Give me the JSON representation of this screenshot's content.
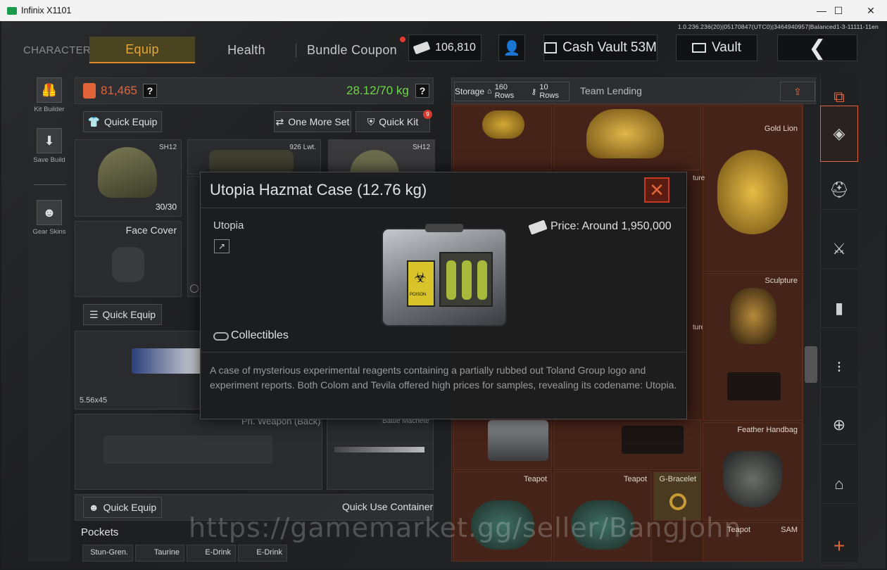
{
  "window": {
    "title": "Infinix X1101",
    "minimize": "—",
    "maximize": "☐",
    "close": "✕"
  },
  "version": "1.0.236.236(20)|05170847(UTC0)|3464940957|Balanced1-3-11111-11en",
  "tabs": {
    "character": "CHARACTER",
    "equip": "Equip",
    "health": "Health",
    "bundle": "Bundle Coupon"
  },
  "currency": {
    "cash": "106,810",
    "cash_vault": "Cash Vault 53M",
    "vault": "Vault"
  },
  "left_nav": {
    "kit_builder": "Kit Builder",
    "save_build": "Save Build",
    "gear_skins": "Gear Skins"
  },
  "loadout": {
    "value": "81,465",
    "weight": "28.12/70 kg",
    "quick_equip": "Quick Equip",
    "one_more_set": "One More Set",
    "quick_kit": "Quick Kit",
    "quick_kit_badge": "9",
    "helmet_tag": "SH12",
    "helmet_durability": "30/30",
    "armor_tag": "926 Lwt.",
    "helmet2_tag": "SH12",
    "face_cover": "Face Cover",
    "quick_equip_2": "Quick Equip",
    "ammo": "5.56x45",
    "pri_weapon_back": "Pri. Weapon (Back)",
    "battle_machete": "Battle Machete",
    "quick_equip_3": "Quick Equip",
    "quick_use_container": "Quick Use Container",
    "pockets": "Pockets",
    "pocket_items": [
      "Stun-Gren.",
      "Taurine",
      "E-Drink",
      "E-Drink"
    ]
  },
  "storage": {
    "label": "Storage",
    "rows1": "160 Rows",
    "rows2": "10 Rows",
    "team_lending": "Team Lending",
    "items": {
      "gold_lion": "Gold Lion",
      "sculpture": "Sculpture",
      "sculpture_partial_1": "ture",
      "sculpture_partial_2": "ture",
      "feather_handbag": "Feather Handbag",
      "teapot1": "Teapot",
      "teapot2": "Teapot",
      "g_bracelet": "G-Bracelet",
      "teapot3": "Teapot",
      "sam": "SAM"
    }
  },
  "modal": {
    "title": "Utopia Hazmat Case (12.76 kg)",
    "subtitle": "Utopia",
    "price": "Price: Around 1,950,000",
    "category": "Collectibles",
    "description": "A case of mysterious experimental reagents containing a partially rubbed out Toland Group logo and experiment reports. Both Colom and Tevila offered high prices for samples, revealing its codename: Utopia.",
    "case_label": "POISON"
  },
  "watermark": "https://gamemarket.gg/seller/BangJohn",
  "colors": {
    "accent": "#e8a53a",
    "weight_green": "#6fd64a",
    "value_orange": "#e0643a",
    "close_red": "#c8391f"
  }
}
